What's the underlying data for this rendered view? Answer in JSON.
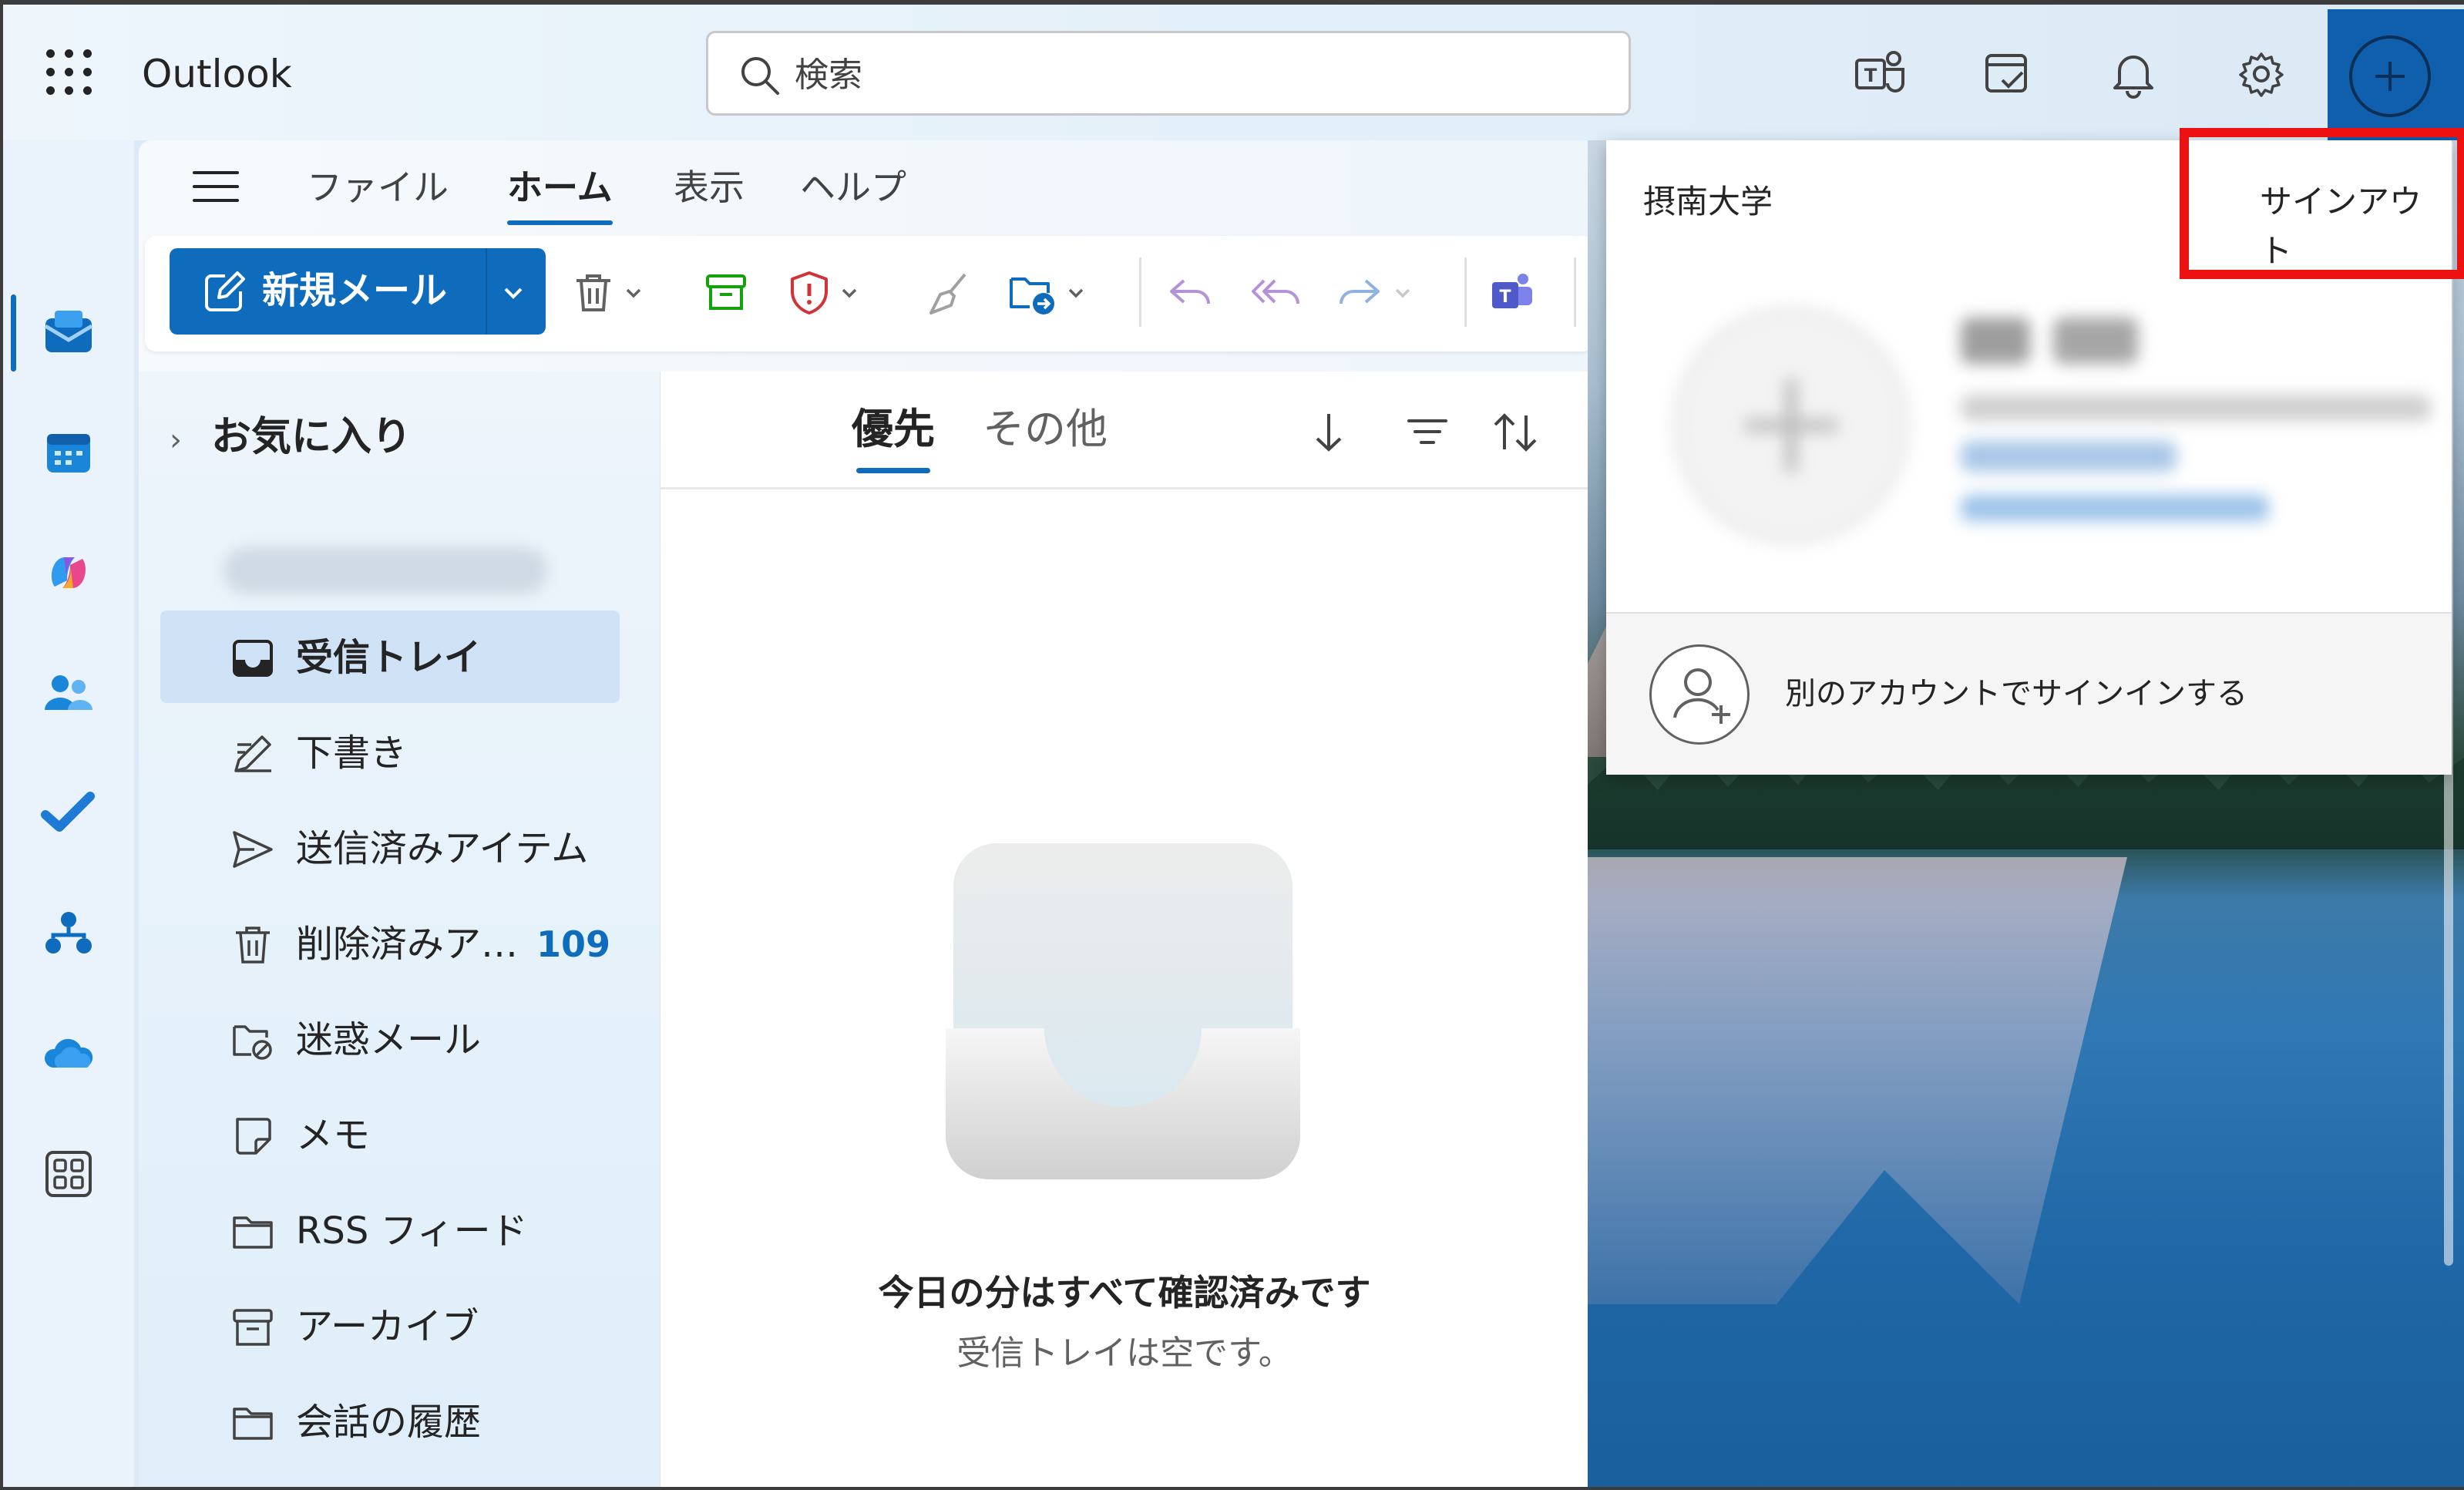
{
  "app": {
    "name": "Outlook"
  },
  "search": {
    "placeholder": "検索"
  },
  "header_icons": [
    "teams-icon",
    "my-day-icon",
    "notifications-bell-icon",
    "settings-gear-icon",
    "account-plus-icon"
  ],
  "ribbon": {
    "tabs": [
      {
        "label": "ファイル",
        "active": false
      },
      {
        "label": "ホーム",
        "active": true
      },
      {
        "label": "表示",
        "active": false
      },
      {
        "label": "ヘルプ",
        "active": false
      }
    ],
    "new_mail_label": "新規メール",
    "tools": [
      "delete-icon",
      "archive-icon",
      "report-icon",
      "sweep-icon",
      "move-to-icon",
      "reply-icon",
      "reply-all-icon",
      "forward-icon",
      "teams-share-icon"
    ]
  },
  "rail": {
    "apps": [
      "mail-icon",
      "calendar-icon",
      "copilot-icon",
      "people-icon",
      "todo-icon",
      "org-explorer-icon",
      "onedrive-icon",
      "more-apps-icon"
    ],
    "active": "mail-icon"
  },
  "folders": {
    "favorites_label": "お気に入り",
    "items": [
      {
        "name": "受信トレイ",
        "icon": "inbox-icon",
        "count": "",
        "active": true
      },
      {
        "name": "下書き",
        "icon": "drafts-icon",
        "count": ""
      },
      {
        "name": "送信済みアイテム",
        "icon": "sent-icon",
        "count": ""
      },
      {
        "name": "削除済みア…",
        "icon": "trash-icon",
        "count": "109"
      },
      {
        "name": "迷惑メール",
        "icon": "junk-icon",
        "count": ""
      },
      {
        "name": "メモ",
        "icon": "notes-icon",
        "count": ""
      },
      {
        "name": "RSS フィード",
        "icon": "folder-icon",
        "count": ""
      },
      {
        "name": "アーカイブ",
        "icon": "archive-folder-icon",
        "count": ""
      },
      {
        "name": "会話の履歴",
        "icon": "folder-icon",
        "count": ""
      }
    ]
  },
  "message_list": {
    "tabs": [
      {
        "label": "優先",
        "active": true
      },
      {
        "label": "その他",
        "active": false
      }
    ],
    "empty_title": "今日の分はすべて確認済みです",
    "empty_subtitle": "受信トレイは空です。"
  },
  "account_flyout": {
    "organization": "摂南大学",
    "sign_out": "サインアウト",
    "add_account": "別のアカウントでサインインする"
  },
  "colors": {
    "accent": "#0f6cbd",
    "highlight_box": "#ee1111"
  }
}
